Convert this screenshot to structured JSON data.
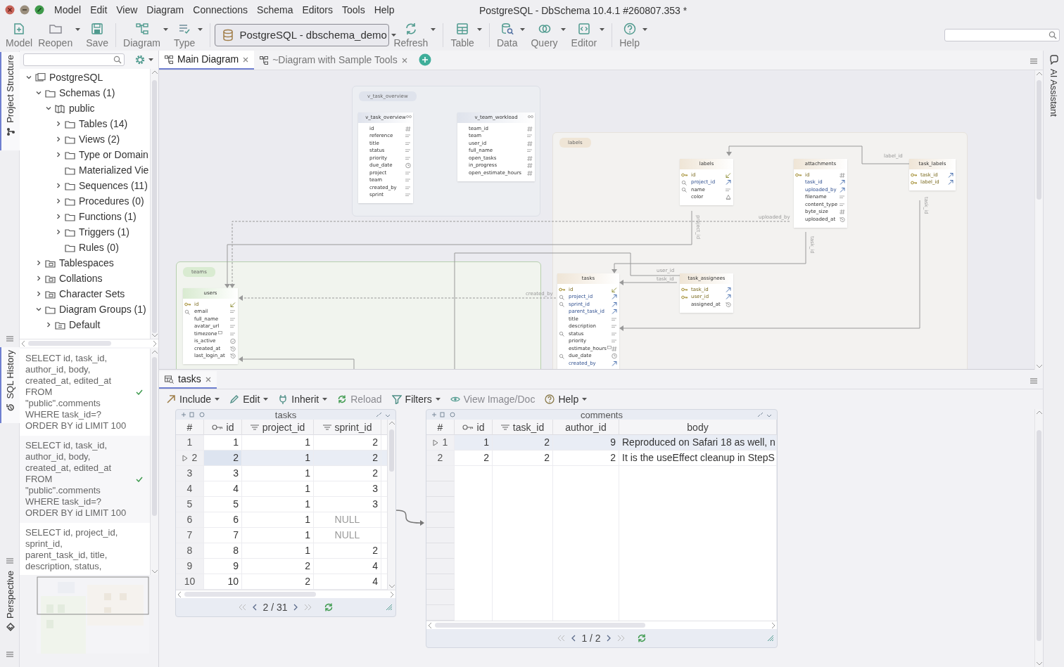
{
  "window": {
    "title": "PostgreSQL - DbSchema 10.4.1 #260807.353 *"
  },
  "menu": [
    "Model",
    "Edit",
    "View",
    "Diagram",
    "Connections",
    "Schema",
    "Editors",
    "Tools",
    "Help"
  ],
  "toolbar": {
    "groups": [
      {
        "items": [
          {
            "kind": "button",
            "label": "Model",
            "dropdown": false
          },
          {
            "kind": "button",
            "label": "Reopen",
            "dropdown": true
          },
          {
            "kind": "button",
            "label": "Save",
            "dropdown": false
          }
        ]
      },
      {
        "items": [
          {
            "kind": "button",
            "label": "Diagram",
            "dropdown": true
          },
          {
            "kind": "button",
            "label": "Type",
            "dropdown": true
          }
        ]
      },
      {
        "items": [
          {
            "kind": "select",
            "label": "PostgreSQL - dbschema_demo",
            "dropdown": true
          },
          {
            "kind": "button",
            "label": "Refresh",
            "dropdown": true
          }
        ]
      },
      {
        "items": [
          {
            "kind": "button",
            "label": "Table",
            "dropdown": true
          }
        ]
      },
      {
        "items": [
          {
            "kind": "button",
            "label": "Data",
            "dropdown": true
          },
          {
            "kind": "button",
            "label": "Query",
            "dropdown": true
          },
          {
            "kind": "button",
            "label": "Editor",
            "dropdown": true
          }
        ]
      },
      {
        "items": [
          {
            "kind": "button",
            "label": "Help",
            "dropdown": true
          }
        ]
      }
    ]
  },
  "left_tabs": [
    {
      "label": "Project Structure",
      "selected": true
    },
    {
      "label": "SQL History",
      "selected": true
    },
    {
      "label": "Perspective",
      "selected": false
    }
  ],
  "right_tabs": [
    "AI Assistant"
  ],
  "tree": [
    {
      "label": "PostgreSQL",
      "kind": "database",
      "expandable": true,
      "expanded": true,
      "children": [
        {
          "label": "Schemas (1)",
          "kind": "folder",
          "expandable": true,
          "expanded": true,
          "children": [
            {
              "label": "public",
              "kind": "schema",
              "expandable": true,
              "expanded": true,
              "children": [
                {
                  "label": "Tables (14)",
                  "kind": "folder",
                  "expandable": true,
                  "expanded": false
                },
                {
                  "label": "Views (2)",
                  "kind": "folder",
                  "expandable": true,
                  "expanded": false
                },
                {
                  "label": "Type or Domain",
                  "kind": "folder",
                  "expandable": true,
                  "expanded": false
                },
                {
                  "label": "Materialized Vie",
                  "kind": "folder",
                  "expandable": false
                },
                {
                  "label": "Sequences (11)",
                  "kind": "folder",
                  "expandable": true,
                  "expanded": false
                },
                {
                  "label": "Procedures (0)",
                  "kind": "folder",
                  "expandable": true,
                  "expanded": false
                },
                {
                  "label": "Functions (1)",
                  "kind": "folder",
                  "expandable": true,
                  "expanded": false
                },
                {
                  "label": "Triggers (1)",
                  "kind": "folder",
                  "expandable": true,
                  "expanded": false
                },
                {
                  "label": "Rules (0)",
                  "kind": "folder",
                  "expandable": false
                }
              ]
            }
          ]
        },
        {
          "label": "Tablespaces",
          "kind": "special",
          "expandable": true,
          "expanded": false
        },
        {
          "label": "Collations",
          "kind": "special",
          "expandable": true,
          "expanded": false
        },
        {
          "label": "Character Sets",
          "kind": "special",
          "expandable": true,
          "expanded": false
        },
        {
          "label": "Diagram Groups (1)",
          "kind": "folder",
          "expandable": true,
          "expanded": true,
          "children": [
            {
              "label": "Default",
              "kind": "group",
              "expandable": true,
              "expanded": false
            }
          ]
        }
      ]
    }
  ],
  "sql_history": [
    {
      "text": "SELECT id, task_id,\nauthor_id, body,\ncreated_at, edited_at\nFROM\n\"public\".comments\nWHERE task_id=?\nORDER BY id LIMIT 100",
      "succeeded": true
    },
    {
      "text": "SELECT id, task_id,\nauthor_id, body,\ncreated_at, edited_at\nFROM\n\"public\".comments\nWHERE task_id=?\nORDER BY id LIMIT 100",
      "succeeded": true
    },
    {
      "text": "SELECT id, project_id,\nsprint_id,\nparent_task_id, title,\ndescription, status,",
      "succeeded": false
    }
  ],
  "diagram_tabs": [
    {
      "label": "Main Diagram",
      "selected": true
    },
    {
      "label": "~Diagram with Sample Tools",
      "selected": false
    }
  ],
  "diagram": {
    "groups": [
      {
        "label": "v_task_overview",
        "color": "#dfe3ec",
        "tables": [
          {
            "name": "v_task_overview",
            "view": true,
            "columns": [
              {
                "name": "id",
                "kind": "plain-number",
                "note": false
              },
              {
                "name": "reference",
                "kind": "plain-text",
                "note": false
              },
              {
                "name": "title",
                "kind": "plain-text",
                "note": false
              },
              {
                "name": "status",
                "kind": "plain-text",
                "note": false
              },
              {
                "name": "priority",
                "kind": "plain-text",
                "note": false
              },
              {
                "name": "due_date",
                "kind": "plain-clock",
                "note": false
              },
              {
                "name": "project",
                "kind": "plain-text",
                "note": false
              },
              {
                "name": "team",
                "kind": "plain-text",
                "note": false
              },
              {
                "name": "created_by",
                "kind": "plain-text",
                "note": false
              },
              {
                "name": "sprint",
                "kind": "plain-text",
                "note": false
              }
            ]
          },
          {
            "name": "v_team_workload",
            "view": true,
            "columns": [
              {
                "name": "team_id",
                "kind": "plain-number",
                "note": false
              },
              {
                "name": "team",
                "kind": "plain-text",
                "note": false
              },
              {
                "name": "user_id",
                "kind": "plain-number",
                "note": false
              },
              {
                "name": "full_name",
                "kind": "plain-text",
                "note": false
              },
              {
                "name": "open_tasks",
                "kind": "plain-number",
                "note": false
              },
              {
                "name": "in_progress",
                "kind": "plain-number",
                "note": false
              },
              {
                "name": "open_estimate_hours",
                "kind": "plain-number",
                "note": false
              }
            ]
          }
        ]
      },
      {
        "label": "labels",
        "color": "#efe5d6",
        "tables": [
          {
            "name": "labels",
            "view": false,
            "columns": [
              {
                "name": "id",
                "kind": "pk-ref",
                "note": false
              },
              {
                "name": "project_id",
                "kind": "index-fk",
                "note": false
              },
              {
                "name": "name",
                "kind": "index-text",
                "note": false
              },
              {
                "name": "color",
                "kind": "plain-shape",
                "note": false
              }
            ]
          },
          {
            "name": "attachments",
            "view": false,
            "columns": [
              {
                "name": "id",
                "kind": "pk-number",
                "note": false
              },
              {
                "name": "task_id",
                "kind": "plain-fk",
                "note": false
              },
              {
                "name": "uploaded_by",
                "kind": "plain-fk",
                "note": false
              },
              {
                "name": "filename",
                "kind": "plain-text",
                "note": false
              },
              {
                "name": "content_type",
                "kind": "plain-text",
                "note": false
              },
              {
                "name": "byte_size",
                "kind": "plain-number",
                "note": false
              },
              {
                "name": "uploaded_at",
                "kind": "plain-history",
                "note": false
              }
            ]
          },
          {
            "name": "task_labels",
            "view": false,
            "columns": [
              {
                "name": "task_id",
                "kind": "pk-fk",
                "note": false
              },
              {
                "name": "label_id",
                "kind": "pk-fk",
                "note": false
              }
            ]
          },
          {
            "name": "tasks",
            "view": false,
            "columns": [
              {
                "name": "id",
                "kind": "pk-ref",
                "note": false
              },
              {
                "name": "project_id",
                "kind": "index-fk",
                "note": false
              },
              {
                "name": "sprint_id",
                "kind": "index-fk",
                "note": false
              },
              {
                "name": "parent_task_id",
                "kind": "plain-fk",
                "note": false
              },
              {
                "name": "title",
                "kind": "plain-text",
                "note": false
              },
              {
                "name": "description",
                "kind": "plain-text",
                "note": false
              },
              {
                "name": "status",
                "kind": "index-text",
                "note": false
              },
              {
                "name": "priority",
                "kind": "plain-text",
                "note": false
              },
              {
                "name": "estimate_hours",
                "kind": "plain-number",
                "note": true
              },
              {
                "name": "due_date",
                "kind": "index-clock",
                "note": false
              },
              {
                "name": "created_by",
                "kind": "plain-fk",
                "note": false
              }
            ]
          },
          {
            "name": "task_assignees",
            "view": false,
            "columns": [
              {
                "name": "task_id",
                "kind": "pk-fk",
                "note": false
              },
              {
                "name": "user_id",
                "kind": "pk-fk",
                "note": false
              },
              {
                "name": "assigned_at",
                "kind": "plain-history",
                "note": false
              }
            ]
          }
        ]
      },
      {
        "label": "teams",
        "color": "#d9ebd1",
        "tables": [
          {
            "name": "users",
            "view": false,
            "columns": [
              {
                "name": "id",
                "kind": "pk-ref",
                "note": false
              },
              {
                "name": "email",
                "kind": "index-text",
                "note": false
              },
              {
                "name": "full_name",
                "kind": "plain-text",
                "note": false
              },
              {
                "name": "avatar_url",
                "kind": "plain-text",
                "note": false
              },
              {
                "name": "timezone",
                "kind": "plain-text",
                "note": true
              },
              {
                "name": "is_active",
                "kind": "plain-check",
                "note": false
              },
              {
                "name": "created_at",
                "kind": "plain-history",
                "note": false
              },
              {
                "name": "last_login_at",
                "kind": "plain-history",
                "note": false
              }
            ]
          }
        ]
      }
    ],
    "relations": [
      {
        "label": "label_id"
      },
      {
        "label": "uploaded_by"
      },
      {
        "label": "project_id"
      },
      {
        "label": "task_id"
      },
      {
        "label": "task_id"
      },
      {
        "label": "created_by"
      },
      {
        "label": "user_id"
      },
      {
        "label": "task_id"
      }
    ]
  },
  "data_panel": {
    "tab": "tasks",
    "toolbar": [
      {
        "label": "Include",
        "dropdown": true,
        "disabled": false
      },
      {
        "label": "Edit",
        "dropdown": true,
        "disabled": false
      },
      {
        "label": "Inherit",
        "dropdown": true,
        "disabled": false
      },
      {
        "label": "Reload",
        "dropdown": false,
        "disabled": true
      },
      {
        "label": "Filters",
        "dropdown": true,
        "disabled": false
      },
      {
        "label": "View Image/Doc",
        "dropdown": false,
        "disabled": true
      },
      {
        "label": "Help",
        "dropdown": true,
        "disabled": false
      }
    ],
    "grids": [
      {
        "title": "tasks",
        "page": "2 / 31",
        "columns": [
          {
            "label": "#",
            "kind": "rownum"
          },
          {
            "label": "id",
            "kind": "pk"
          },
          {
            "label": "project_id",
            "kind": "fk"
          },
          {
            "label": "sprint_id",
            "kind": "fk"
          }
        ],
        "rows": [
          {
            "selected": false,
            "cells": [
              "1",
              "1",
              "1",
              "2"
            ]
          },
          {
            "selected": true,
            "cells": [
              "2",
              "2",
              "1",
              "2"
            ]
          },
          {
            "selected": false,
            "cells": [
              "3",
              "3",
              "1",
              "2"
            ]
          },
          {
            "selected": false,
            "cells": [
              "4",
              "4",
              "1",
              "3"
            ]
          },
          {
            "selected": false,
            "cells": [
              "5",
              "5",
              "1",
              "3"
            ]
          },
          {
            "selected": false,
            "cells": [
              "6",
              "6",
              "1",
              {
                "text": "NULL",
                "kind": "null"
              }
            ]
          },
          {
            "selected": false,
            "cells": [
              "7",
              "7",
              "1",
              {
                "text": "NULL",
                "kind": "null"
              }
            ]
          },
          {
            "selected": false,
            "cells": [
              "8",
              "8",
              "1",
              "2"
            ]
          },
          {
            "selected": false,
            "cells": [
              "9",
              "9",
              "2",
              "4"
            ]
          },
          {
            "selected": false,
            "cells": [
              "10",
              "10",
              "2",
              "4"
            ]
          }
        ]
      },
      {
        "title": "comments",
        "page": "1 / 2",
        "columns": [
          {
            "label": "#",
            "kind": "rownum"
          },
          {
            "label": "id",
            "kind": "pk"
          },
          {
            "label": "task_id",
            "kind": "fk"
          },
          {
            "label": "author_id",
            "kind": "number"
          },
          {
            "label": "body",
            "kind": "text"
          }
        ],
        "rows": [
          {
            "selected": true,
            "cells": [
              "1",
              "1",
              "2",
              "9",
              "Reproduced on Safari 18 as well, n"
            ]
          },
          {
            "selected": false,
            "cells": [
              "2",
              "2",
              "2",
              "2",
              "It is the useEffect cleanup in StepS"
            ]
          }
        ]
      }
    ]
  }
}
